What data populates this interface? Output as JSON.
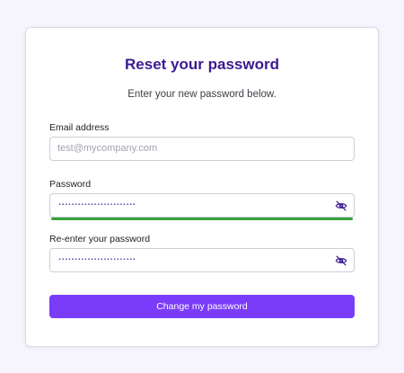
{
  "form": {
    "title": "Reset your password",
    "subtitle": "Enter your new password below.",
    "email": {
      "label": "Email address",
      "placeholder": "test@mycompany.com"
    },
    "password": {
      "label": "Password",
      "masked_value": "••••••••••••••••••••••••",
      "toggle_icon": "eye-slash-icon",
      "strength_color": "#37a23b"
    },
    "confirm_password": {
      "label": "Re-enter your password",
      "masked_value": "••••••••••••••••••••••••",
      "toggle_icon": "eye-slash-icon"
    },
    "submit_label": "Change my password"
  },
  "colors": {
    "background": "#f6f4fc",
    "title": "#3b1a91",
    "button": "#7a3cf8"
  }
}
